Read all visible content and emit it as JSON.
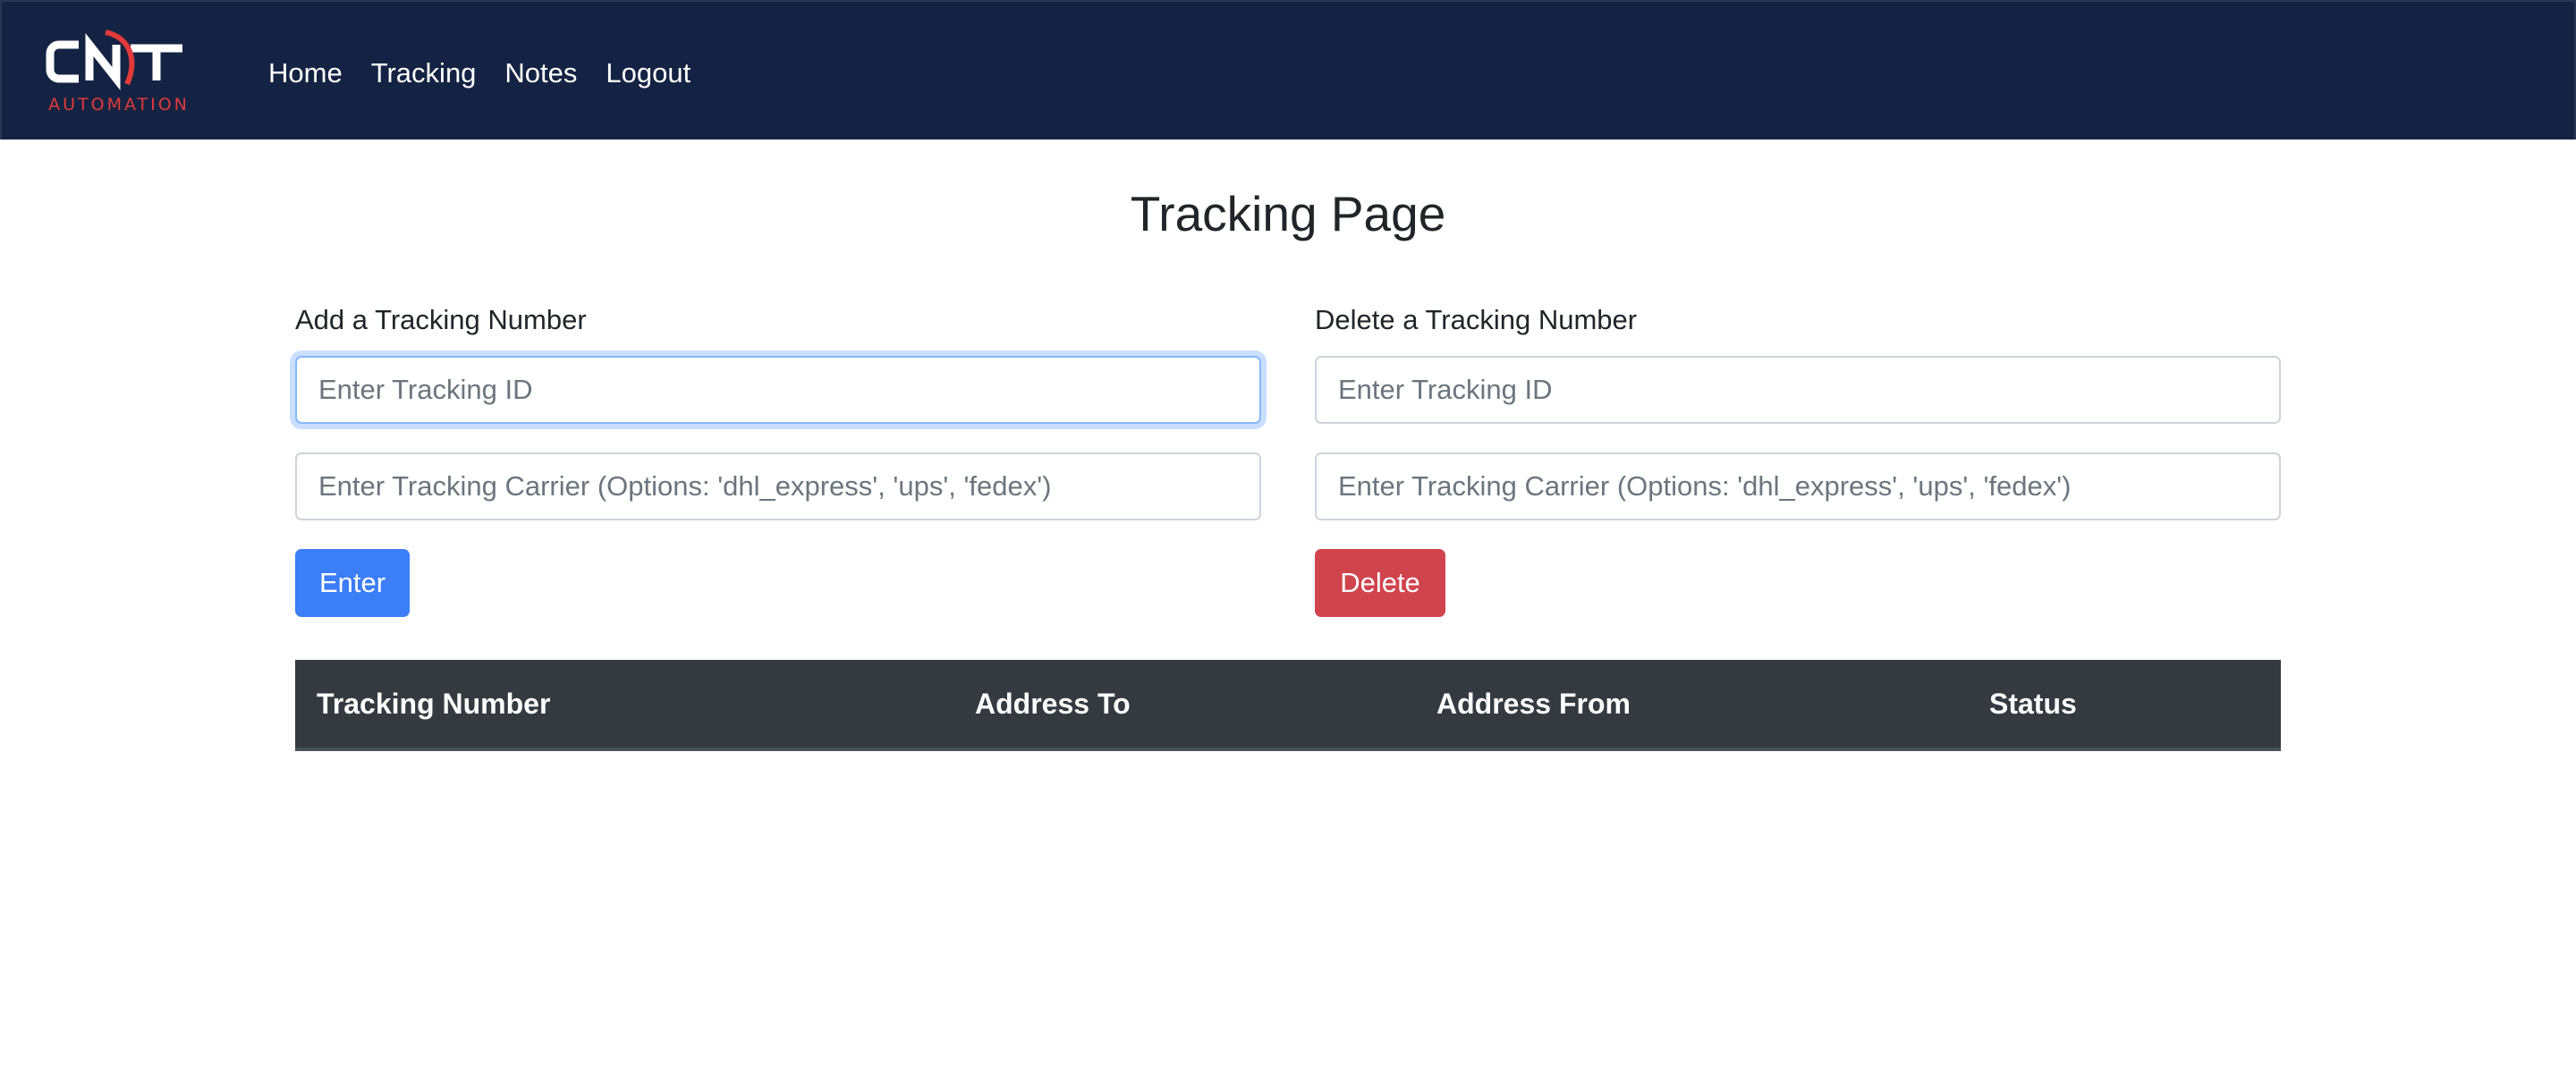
{
  "brand": {
    "logo_text": "CNT",
    "logo_subtext": "AUTOMATION",
    "accent_color": "#e03a3a",
    "nav_background": "#142343"
  },
  "nav": {
    "items": [
      {
        "label": "Home"
      },
      {
        "label": "Tracking"
      },
      {
        "label": "Notes"
      },
      {
        "label": "Logout"
      }
    ]
  },
  "page": {
    "title": "Tracking Page"
  },
  "add_form": {
    "label": "Add a Tracking Number",
    "id_placeholder": "Enter Tracking ID",
    "id_value": "",
    "carrier_placeholder": "Enter Tracking Carrier (Options: 'dhl_express', 'ups', 'fedex')",
    "carrier_value": "",
    "button_label": "Enter",
    "button_color": "#3b7ef6"
  },
  "delete_form": {
    "label": "Delete a Tracking Number",
    "id_placeholder": "Enter Tracking ID",
    "id_value": "",
    "carrier_placeholder": "Enter Tracking Carrier (Options: 'dhl_express', 'ups', 'fedex')",
    "carrier_value": "",
    "button_label": "Delete",
    "button_color": "#d0444e"
  },
  "table": {
    "columns": [
      "Tracking Number",
      "Address To",
      "Address From",
      "Status"
    ],
    "rows": []
  }
}
